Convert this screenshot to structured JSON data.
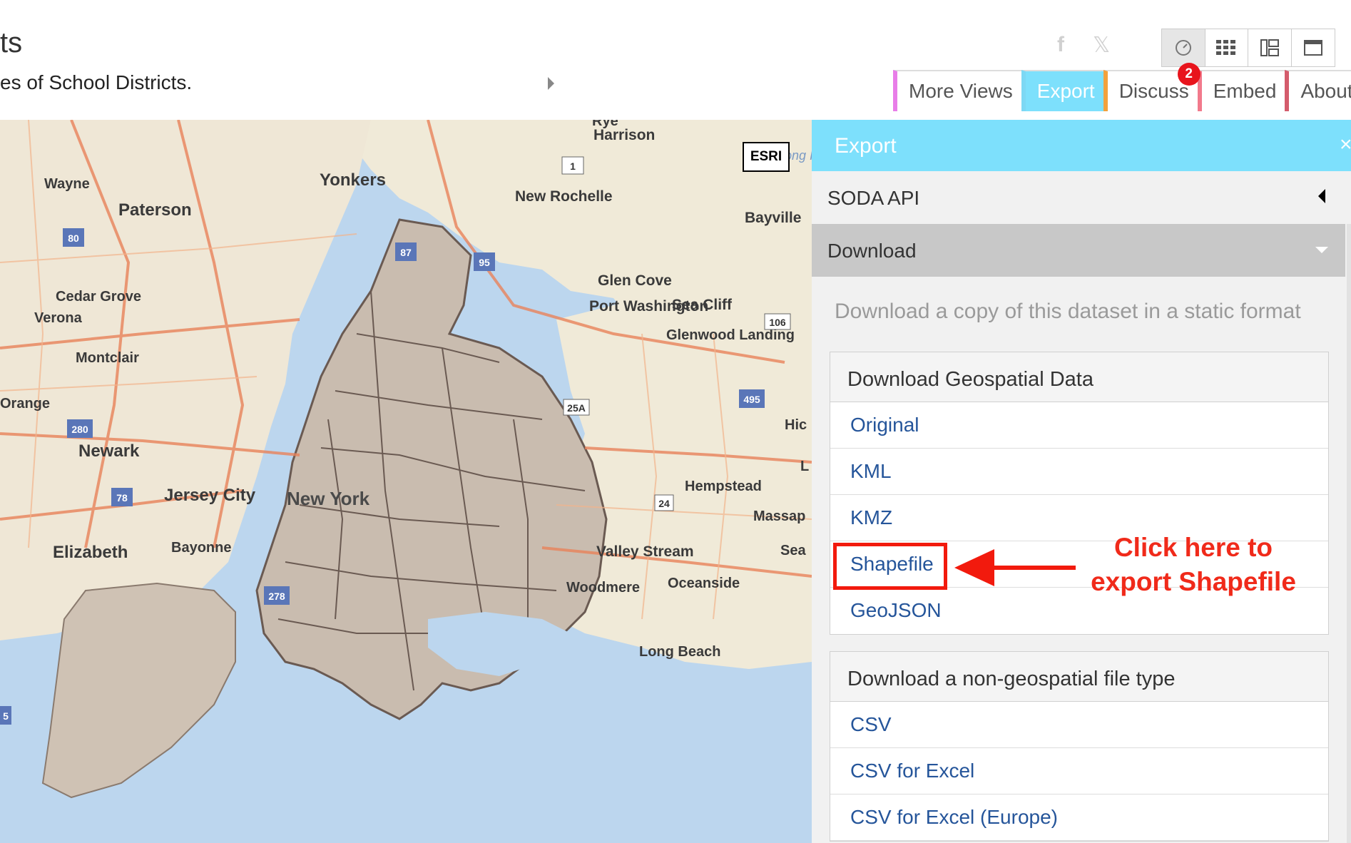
{
  "page": {
    "title": "ts",
    "description": "es of School Districts."
  },
  "header": {
    "social": {
      "facebook_icon": "facebook-icon",
      "x_icon": "x-icon"
    },
    "view_buttons": [
      "speedometer-icon",
      "grid-icon",
      "cards-icon",
      "window-icon"
    ],
    "tabs": [
      {
        "label": "More Views",
        "color": "#e87de8"
      },
      {
        "label": "Export",
        "color": "#7de0fc"
      },
      {
        "label": "Discuss",
        "color": "#f2a13c"
      },
      {
        "label": "Embed",
        "color": "#f27a8c"
      },
      {
        "label": "About",
        "color": "#d45c6c"
      }
    ],
    "discuss_badge": "2"
  },
  "map": {
    "attribution": "ESRI",
    "labels": [
      "Rye",
      "Harrison",
      "Yonkers",
      "Wayne",
      "Paterson",
      "New Rochelle",
      "Bayville",
      "Long Island Sound",
      "Glen Cove",
      "Port Washington",
      "Sea Cliff",
      "Glenwood Landing",
      "Cedar Grove",
      "Verona",
      "Montclair",
      "Orange",
      "Newark",
      "Jersey City",
      "New York",
      "Elizabeth",
      "Bayonne",
      "Hempstead",
      "Massap",
      "Valley Stream",
      "Woodmere",
      "Oceanside",
      "Sea",
      "Long Beach",
      "Hic",
      "L"
    ],
    "shields": [
      "1",
      "80",
      "87",
      "95",
      "106",
      "25A",
      "495",
      "280",
      "78",
      "24",
      "278",
      "5"
    ]
  },
  "panel": {
    "title": "Export",
    "close": "×",
    "soda_api": "SODA API",
    "download": "Download",
    "intro": "Download a copy of this dataset in a static format",
    "geo": {
      "heading": "Download Geospatial Data",
      "items": [
        "Original",
        "KML",
        "KMZ",
        "Shapefile",
        "GeoJSON"
      ]
    },
    "nongeo": {
      "heading": "Download a non-geospatial file type",
      "items": [
        "CSV",
        "CSV for Excel",
        "CSV for Excel (Europe)"
      ]
    }
  },
  "annotation": {
    "line1": "Click here to",
    "line2": "export Shapefile",
    "color": "#f02a1a"
  }
}
